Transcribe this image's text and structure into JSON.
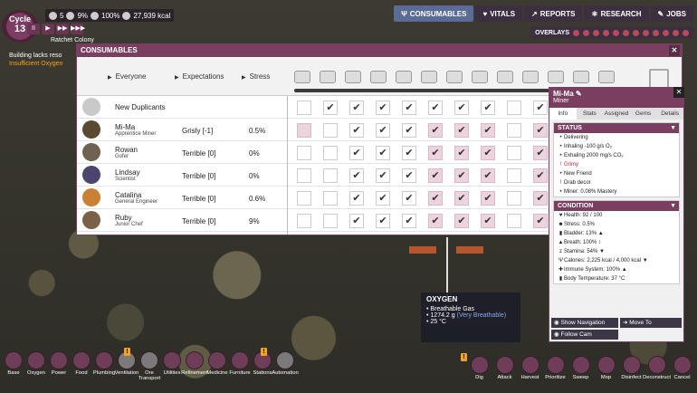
{
  "top": {
    "cycle_label": "Cycle",
    "cycle_number": "13",
    "dupes": "5",
    "stress_pct": "9%",
    "sun_pct": "100%",
    "calories": "27,939 kcal",
    "colony_name": "Ratchet Colony",
    "alerts": [
      "Building lacks reso",
      "Insufficient Oxygen"
    ],
    "speed_buttons": [
      "II",
      "▶",
      "▶▶",
      "▶▶▶"
    ],
    "nav": [
      {
        "icon": "fork-knife-icon",
        "label": "CONSUMABLES",
        "active": true
      },
      {
        "icon": "heart-icon",
        "label": "VITALS",
        "active": false
      },
      {
        "icon": "chart-icon",
        "label": "REPORTS",
        "active": false
      },
      {
        "icon": "research-icon",
        "label": "RESEARCH",
        "active": false
      },
      {
        "icon": "wrench-icon",
        "label": "JOBS",
        "active": false
      }
    ],
    "overlays_label": "OVERLAYS"
  },
  "consumables": {
    "title": "CONSUMABLES",
    "columns": {
      "everyone": "Everyone",
      "expectations": "Expectations",
      "stress": "Stress"
    },
    "food_icons": [
      "mush-bar-icon",
      "root-icon",
      "meal-lice-icon",
      "berry-icon",
      "bar-icon",
      "liceloaf-icon",
      "pepper-bread-icon",
      "fried-mush-icon",
      "stew-icon",
      "spicy-tofu-icon",
      "surf-turf-icon",
      "frost-burger-icon",
      "burger-icon"
    ],
    "rows": [
      {
        "name": "New Duplicants",
        "role": "",
        "expectation": "",
        "stress": "",
        "avatar": "#c9c9c9",
        "checks": [
          0,
          1,
          1,
          1,
          1,
          1,
          1,
          1,
          0,
          1
        ],
        "pink": [
          0,
          0,
          0,
          0,
          0,
          0,
          0,
          0,
          0,
          0
        ]
      },
      {
        "name": "Mi-Ma",
        "role": "Apprentice Miner",
        "expectation": "Grisly [-1]",
        "stress": "0.5%",
        "avatar": "#5a4a32",
        "checks": [
          0,
          0,
          1,
          1,
          1,
          1,
          1,
          1,
          0,
          1
        ],
        "pink": [
          1,
          0,
          0,
          0,
          0,
          1,
          1,
          1,
          0,
          1
        ]
      },
      {
        "name": "Rowan",
        "role": "Gofer",
        "expectation": "Terrible [0]",
        "stress": "0%",
        "avatar": "#6e6250",
        "checks": [
          0,
          0,
          1,
          1,
          1,
          1,
          1,
          1,
          0,
          1
        ],
        "pink": [
          0,
          0,
          0,
          0,
          0,
          1,
          1,
          1,
          0,
          1
        ]
      },
      {
        "name": "Lindsay",
        "role": "Scientist",
        "expectation": "Terrible [0]",
        "stress": "0%",
        "avatar": "#4e4470",
        "checks": [
          0,
          0,
          1,
          1,
          1,
          1,
          1,
          1,
          0,
          1
        ],
        "pink": [
          0,
          0,
          0,
          0,
          0,
          1,
          1,
          1,
          0,
          1
        ]
      },
      {
        "name": "Catalina",
        "role": "General Engineer",
        "expectation": "Terrible [0]",
        "stress": "0.6%",
        "avatar": "#c98234",
        "checks": [
          0,
          0,
          1,
          1,
          1,
          1,
          1,
          1,
          0,
          1
        ],
        "pink": [
          0,
          0,
          0,
          0,
          0,
          1,
          1,
          1,
          0,
          1
        ]
      },
      {
        "name": "Ruby",
        "role": "Junior Chef",
        "expectation": "Terrible [0]",
        "stress": "9%",
        "avatar": "#7a6248",
        "checks": [
          0,
          0,
          1,
          1,
          1,
          1,
          1,
          1,
          0,
          1
        ],
        "pink": [
          0,
          0,
          0,
          0,
          0,
          1,
          1,
          1,
          0,
          1
        ]
      }
    ]
  },
  "detail": {
    "name": "Mi-Ma",
    "role": "Miner",
    "tabs": [
      "Info",
      "Stats",
      "Assigned",
      "Gems",
      "Details"
    ],
    "status_title": "STATUS",
    "status_items": [
      {
        "icon": "dot",
        "text": "Delivering"
      },
      {
        "icon": "dot",
        "text": "Inhaling -100 g/s O₂"
      },
      {
        "icon": "dot",
        "text": "Exhaling 2000 mg/s CO₂"
      },
      {
        "icon": "alert",
        "text": "Grimy",
        "red": true
      },
      {
        "icon": "dot",
        "text": "New Friend"
      },
      {
        "icon": "alert",
        "text": "Drab decor"
      },
      {
        "icon": "dot",
        "text": "Miner: 0.08% Mastery"
      }
    ],
    "condition_title": "CONDITION",
    "condition_items": [
      {
        "icon": "♥",
        "text": "Health: 92 / 100"
      },
      {
        "icon": "☻",
        "text": "Stress: 0.5%"
      },
      {
        "icon": "▮",
        "text": "Bladder: 13%  ▲"
      },
      {
        "icon": "▲",
        "text": "Breath: 100%  ↕"
      },
      {
        "icon": "z",
        "text": "Stamina: 54%  ▼"
      },
      {
        "icon": "Ψ",
        "text": "Calories: 2,225 kcal / 4,000 kcal  ▼"
      },
      {
        "icon": "✚",
        "text": "Immune System: 100%  ▲"
      },
      {
        "icon": "▮",
        "text": "Body Temperature: 37 °C"
      }
    ],
    "buttons": {
      "show_navigation": "Show Navigation",
      "move_to": "Move To",
      "follow_cam": "Follow Cam"
    }
  },
  "tooltip": {
    "title": "OXYGEN",
    "line1": "Breathable Gas",
    "line2": "1274.2 g",
    "line2b": "(Very Breathable)",
    "line3": "25 °C"
  },
  "build_tools": [
    "Base",
    "Oxygen",
    "Power",
    "Food",
    "Plumbing",
    "Ventilation",
    "Ore Transport",
    "Utilities",
    "Refinement",
    "Medicine",
    "Furniture",
    "Stations",
    "Automation"
  ],
  "action_tools": [
    "Dig",
    "Attack",
    "Harvest",
    "Prioritize",
    "Sweep",
    "Mop",
    "Disinfect",
    "Deconstruct",
    "Cancel"
  ]
}
